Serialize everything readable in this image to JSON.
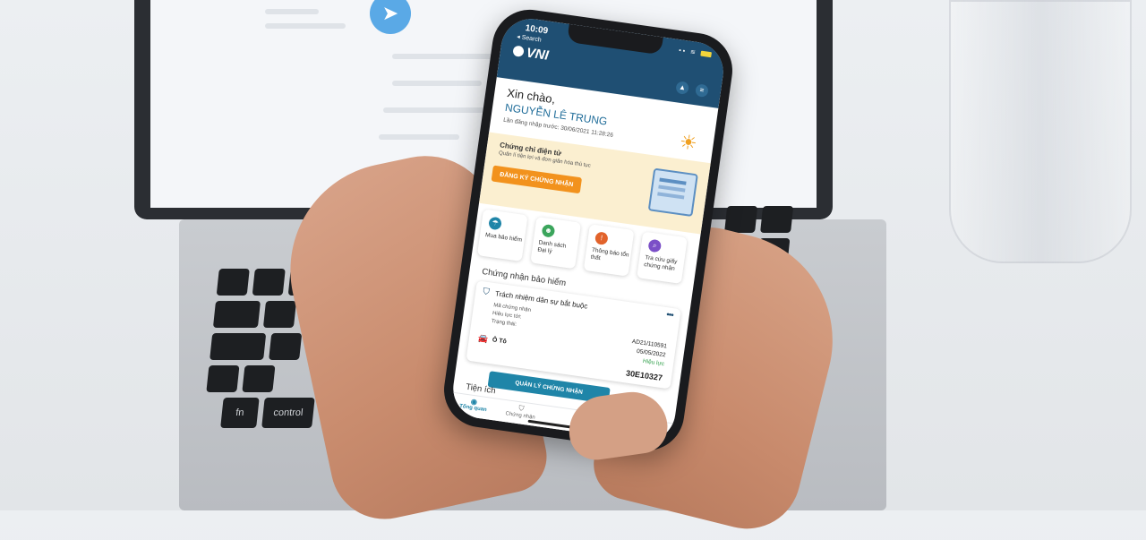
{
  "status_bar": {
    "time": "10:09",
    "back_label": "◂ Search"
  },
  "app": {
    "brand": "VNI"
  },
  "greeting": {
    "hello": "Xin chào,",
    "name": "NGUYỄN LÊ TRUNG",
    "last_login": "Lần đăng nhập trước: 30/06/2021 11:28:26"
  },
  "cert_banner": {
    "title": "Chứng chỉ điện tử",
    "subtitle": "Quản lí tiện lợi và đơn giản hóa thủ tục",
    "button": "ĐĂNG KÝ CHỨNG NHẬN"
  },
  "quick_actions": [
    {
      "label": "Mua bảo hiểm",
      "color": "#1f85a8"
    },
    {
      "label": "Danh sách Đại lý",
      "color": "#3ba55c"
    },
    {
      "label": "Thông báo tổn thất",
      "color": "#e2632b"
    },
    {
      "label": "Tra cứu giấy chứng nhận",
      "color": "#7b4fc7"
    }
  ],
  "insurance_section": {
    "title": "Chứng nhận bảo hiểm",
    "card": {
      "title": "Trách nhiệm dân sự bắt buộc",
      "more": "•••",
      "fields": [
        {
          "label": "Mã chứng nhận",
          "value": "AD21/110591"
        },
        {
          "label": "Hiệu lực tới:",
          "value": "05/05/2022"
        },
        {
          "label": "Trạng thái:",
          "value": "Hiệu lực"
        }
      ],
      "vehicle": "Ô Tô",
      "plate": "30E10327"
    },
    "manage_button": "QUẢN LÝ CHỨNG NHẬN"
  },
  "utilities_title": "Tiện ích",
  "bottom_nav": [
    {
      "label": "Tổng quan",
      "active": true
    },
    {
      "label": "Chứng nhận",
      "active": false
    }
  ],
  "keyboard_labels": [
    "fn",
    "control"
  ],
  "colors": {
    "brand": "#1f4f73",
    "accent_orange": "#f2921d",
    "accent_teal": "#1f85a8",
    "banner_bg": "#fbefd0"
  }
}
